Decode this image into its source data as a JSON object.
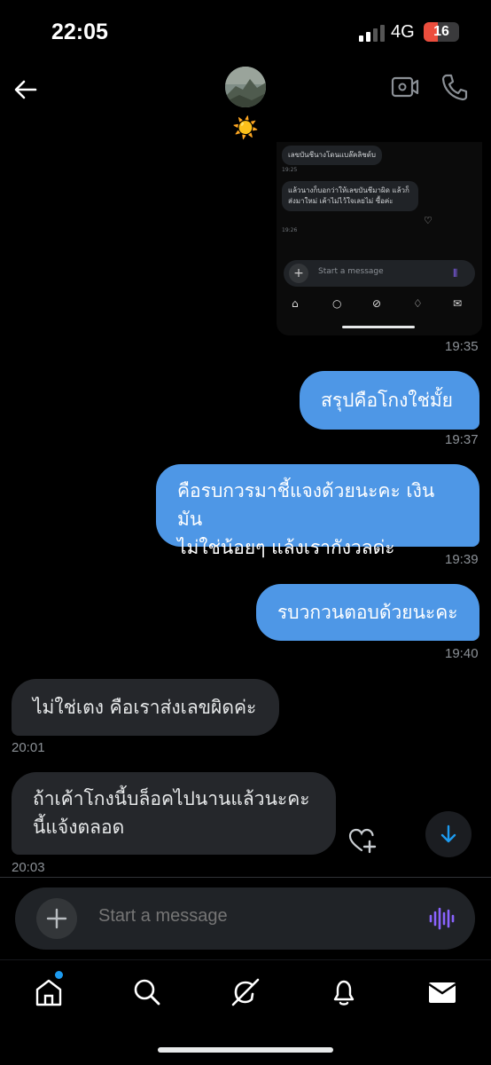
{
  "status_bar": {
    "time": "22:05",
    "network": "4G",
    "battery": "16"
  },
  "header": {
    "status_emoji": "☀️"
  },
  "embedded_screenshot": {
    "messages": [
      {
        "text": "เลขบันชีนางโดนแบล๊คลิชต์บ",
        "time": "19:25"
      },
      {
        "text": "แล้วนางก็บอกว่าให้เลขบันชีมาผิด แล้วก็ส่งมาใหม่ เค้าไม่ไว้ใจเลยไม่ ซื้อค่ะ",
        "time": "19:26"
      }
    ],
    "input_placeholder": "Start a message"
  },
  "conversation": {
    "embedded_time": "19:35",
    "messages": [
      {
        "direction": "out",
        "text": "สรุปคือโกงใช่มั้ย",
        "time": "19:37"
      },
      {
        "direction": "out",
        "text": "คือรบกวรมาชี้แจงด้วยนะคะ เงินมันไม่ใช่น้อยๆ แล้งเรากังวลด่ะ",
        "lines": [
          "คือรบกวรมาชี้แจงด้วยนะคะ เงินมัน",
          "ไม่ใช่น้อยๆ แล้งเรากังวลด่ะ"
        ],
        "time": "19:39"
      },
      {
        "direction": "out",
        "text": "รบวกวนตอบด้วยนะคะ",
        "time": "19:40"
      },
      {
        "direction": "in",
        "text": "ไม่ใช่เตง คือเราส่งเลขผิดค่ะ",
        "time": "20:01"
      },
      {
        "direction": "in",
        "text": "ถ้าเค้าโกงนี้บล็อคไปนานแล้วนะคะ นี้แจ้งตลอด",
        "lines": [
          "ถ้าเค้าโกงนี้บล็อคไปนานแล้วนะคะ",
          "นี้แจ้งตลอด"
        ],
        "time": "20:03"
      }
    ]
  },
  "composer": {
    "placeholder": "Start a message"
  },
  "colors": {
    "accent": "#1d9bf0",
    "outgoing_bubble": "#4e97e6",
    "incoming_bubble": "#25272b",
    "mic": "#8a63ff"
  },
  "icons": [
    "back-arrow-icon",
    "video-call-icon",
    "phone-icon",
    "heart-plus-icon",
    "arrow-down-icon",
    "plus-icon",
    "voice-wave-icon",
    "home-icon",
    "search-icon",
    "grok-icon",
    "bell-icon",
    "mail-icon"
  ]
}
